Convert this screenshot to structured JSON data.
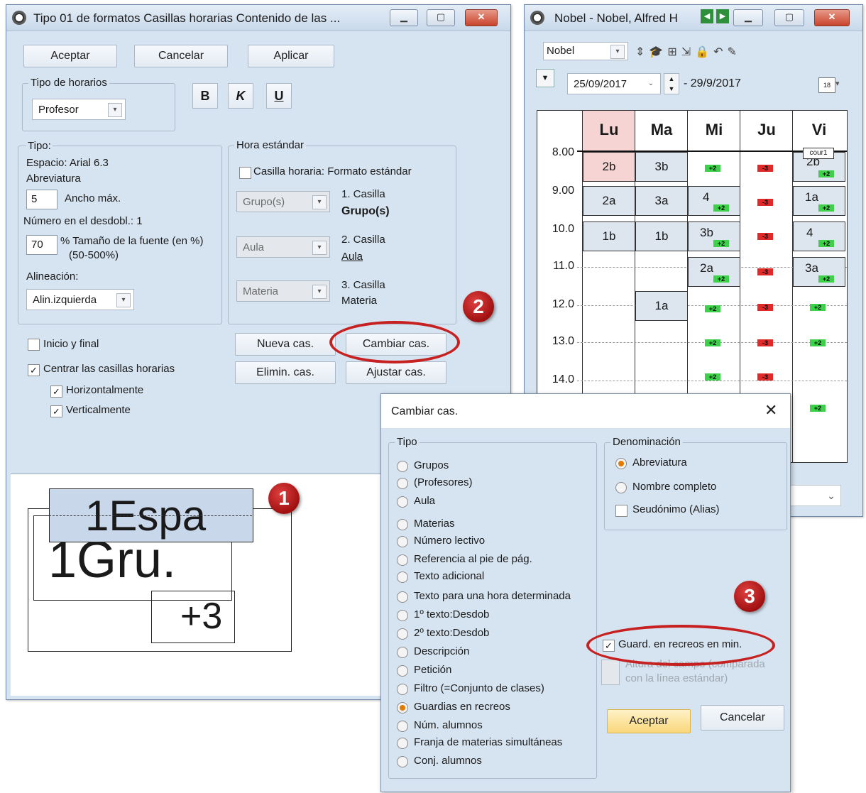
{
  "format_window": {
    "title": "Tipo 01 de formatos  Casillas horarias  Contenido de las ...",
    "buttons": {
      "accept": "Aceptar",
      "cancel": "Cancelar",
      "apply": "Aplicar"
    },
    "schedule_type": {
      "label": "Tipo de horarios",
      "value": "Profesor"
    },
    "format_buttons": {
      "bold": "B",
      "italic": "K",
      "underline": "U"
    },
    "tipo": {
      "label": "Tipo:",
      "line1": "Espacio: Arial 6.3",
      "line2": "Abreviatura",
      "max_width_value": "5",
      "max_width_label": "Ancho máx.",
      "split_number": "Número en el desdobl.: 1",
      "font_size_value": "70",
      "font_size_label": "% Tamaño de la fuente (en %)",
      "font_size_range": "(50-500%)",
      "alignment_label": "Alineación:",
      "alignment_value": "Alin.izquierda"
    },
    "standard_hour": {
      "label": "Hora estándar",
      "checkbox_label": "Casilla horaria: Formato estándar",
      "cells": [
        {
          "combo": "Grupo(s)",
          "title": "1. Casilla",
          "value": "Grupo(s)"
        },
        {
          "combo": "Aula",
          "title": "2. Casilla",
          "value": "Aula"
        },
        {
          "combo": "Materia",
          "title": "3. Casilla",
          "value": "Materia"
        }
      ]
    },
    "options": {
      "start_end": "Inicio y final",
      "center": "Centrar las casillas horarias",
      "horizontal": "Horizontalmente",
      "vertical": "Verticalmente"
    },
    "cell_buttons": {
      "new": "Nueva cas.",
      "change": "Cambiar cas.",
      "delete": "Elimin. cas.",
      "adjust": "Ajustar cas."
    },
    "preview": {
      "cell1": "1Espa",
      "cell2": "1Gru.",
      "cell3": "+3"
    }
  },
  "timetable_window": {
    "title": "Nobel - Nobel, Alfred  H",
    "teacher_select": "Nobel",
    "date_from": "25/09/2017",
    "date_to": "- 29/9/2017",
    "days": [
      "Lu",
      "Ma",
      "Mi",
      "Ju",
      "Vi"
    ],
    "times": [
      "8.00",
      "9.00",
      "10.0",
      "11.0",
      "12.0",
      "13.0",
      "14.0"
    ],
    "lessons": {
      "lu": [
        "2b",
        "2a",
        "1b"
      ],
      "ma": [
        "3b",
        "3a",
        "1b",
        "1a"
      ],
      "mi": [
        "4",
        "3b",
        "2a"
      ],
      "vi": [
        "2b",
        "1a",
        "4",
        "3a"
      ]
    },
    "plus_label": "+2",
    "minus_label": "-3",
    "note_label": "cour1"
  },
  "change_dialog": {
    "title": "Cambiar cas.",
    "type_label": "Tipo",
    "types": [
      "Grupos",
      "(Profesores)",
      "Aula",
      "Materias",
      "Número lectivo",
      "Referencia al pie de pág.",
      "Texto adicional",
      "Texto para una hora determinada",
      "1º texto:Desdob",
      "2º texto:Desdob",
      "Descripción",
      "Petición",
      "Filtro (=Conjunto de clases)",
      "Guardias en recreos",
      "Núm. alumnos",
      "Franja de materias simultáneas",
      "Conj. alumnos"
    ],
    "selected_type": "Guardias en recreos",
    "denomination": {
      "label": "Denominación",
      "abbreviation": "Abreviatura",
      "full_name": "Nombre completo",
      "alias": "Seudónimo (Alias)"
    },
    "break_guard_minutes": "Guard. en recreos en min.",
    "field_height": "Altura del campo (comparada",
    "field_height2": "con la línea estándar)",
    "accept": "Aceptar",
    "cancel": "Cancelar"
  },
  "callouts": [
    "1",
    "2",
    "3"
  ],
  "colors": {
    "window_bg": "#d6e3f0",
    "callout_red": "#c62020",
    "highlight_monday": "#f7d4d4",
    "plus_green": "#3ed04a",
    "minus_red": "#e02a2a"
  }
}
